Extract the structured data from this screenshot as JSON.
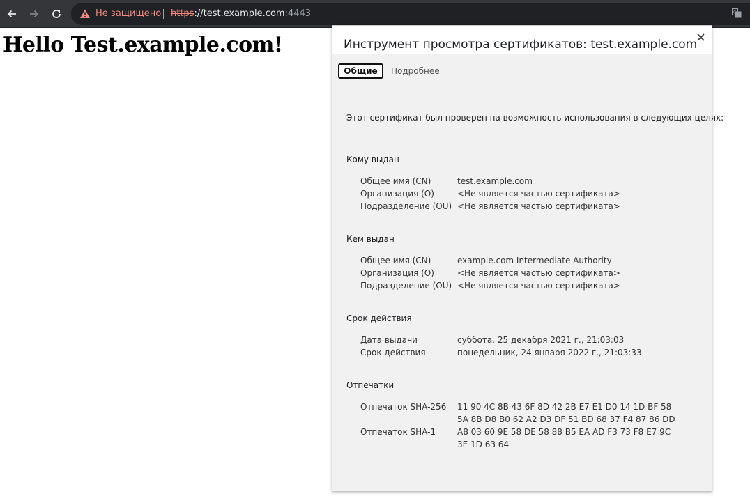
{
  "browser": {
    "not_secure_label": "Не защищено",
    "url_scheme": "https",
    "url_rest": "://test.example.com",
    "url_port": ":4443"
  },
  "page": {
    "heading": "Hello Test.example.com!"
  },
  "dialog": {
    "title": "Инструмент просмотра сертификатов: test.example.com",
    "tabs": [
      {
        "label": "Общие",
        "active": true
      },
      {
        "label": "Подробнее",
        "active": false
      }
    ],
    "intro": "Этот сертификат был проверен на возможность использования в следующих целях:",
    "issued_to": {
      "title": "Кому выдан",
      "rows": [
        {
          "label": "Общее имя (CN)",
          "value": "test.example.com"
        },
        {
          "label": "Организация (O)",
          "value": "<Не является частью сертификата>"
        },
        {
          "label": "Подразделение (OU)",
          "value": "<Не является частью сертификата>"
        }
      ]
    },
    "issued_by": {
      "title": "Кем выдан",
      "rows": [
        {
          "label": "Общее имя (CN)",
          "value": "example.com Intermediate Authority"
        },
        {
          "label": "Организация (O)",
          "value": "<Не является частью сертификата>"
        },
        {
          "label": "Подразделение (OU)",
          "value": "<Не является частью сертификата>"
        }
      ]
    },
    "validity": {
      "title": "Срок действия",
      "rows": [
        {
          "label": "Дата выдачи",
          "value": "суббота, 25 декабря 2021 г., 21:03:03"
        },
        {
          "label": "Срок действия",
          "value": "понедельник, 24 января 2022 г., 21:03:33"
        }
      ]
    },
    "fingerprints": {
      "title": "Отпечатки",
      "sha256_label": "Отпечаток SHA-256",
      "sha256_line1": "11 90 4C 8B 43 6F 8D 42 2B E7 E1 D0 14 1D BF 58",
      "sha256_line2": "5A 8B D8 B0 62 A2 D3 DF 51 BD 68 37 F4 87 86 DD",
      "sha1_label": "Отпечаток SHA-1",
      "sha1_line1": "A8 03 60 9E 58 DE 58 88 B5 EA AD F3 73 F8 E7 9C",
      "sha1_line2": "3E 1D 63 64"
    }
  }
}
